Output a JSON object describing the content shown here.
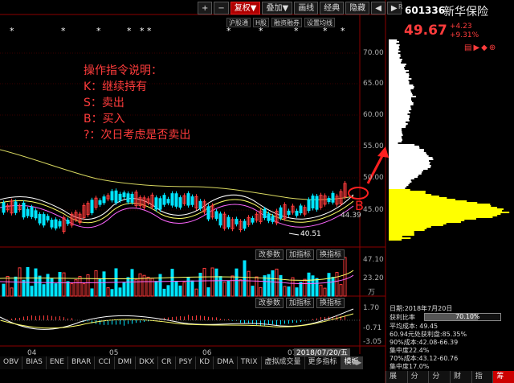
{
  "toolbar": {
    "buttons": [
      "+",
      "−",
      "复权▼",
      "叠加▼",
      "画线",
      "经典",
      "隐藏"
    ],
    "nav_left": "◀",
    "nav_right": "▶"
  },
  "sub_toolbar": {
    "buttons": [
      "沪股通",
      "H股",
      "融资融券",
      "设置均线"
    ]
  },
  "ticker": {
    "code": "601336",
    "name": "新华保险",
    "r_mark": "R"
  },
  "quote": {
    "price": "49.67",
    "change": "+4.23",
    "change_pct": "+9.31%"
  },
  "price_axis": [
    "70.00",
    "65.00",
    "60.00",
    "55.00",
    "50.00",
    "45.00"
  ],
  "annotations": {
    "low_price": "40.51",
    "right_price": "44.39",
    "b_marker": "B"
  },
  "instructions": [
    "操作指令说明：",
    "K：继续持有",
    "S：卖出",
    "B：买入",
    "?：次日考虑是否卖出"
  ],
  "volume_panel": {
    "buttons": [
      "改参数",
      "加指标",
      "换指标"
    ],
    "axis": [
      "47.10",
      "23.20",
      "万"
    ]
  },
  "macd_panel": {
    "buttons": [
      "改参数",
      "加指标",
      "换指标"
    ],
    "axis": [
      "1.70",
      "-0.71",
      "-3.05"
    ]
  },
  "x_axis": [
    "04",
    "05",
    "06",
    "07"
  ],
  "hover_date": "2018/07/20/五",
  "bottom_tabs": [
    "OBV",
    "BIAS",
    "ENE",
    "BRAR",
    "CCI",
    "DMI",
    "DKX",
    "CR",
    "PSY",
    "KD",
    "DMA",
    "TRIX",
    "虚拟成交量",
    "更多指标",
    "模板"
  ],
  "chip_info": [
    "日期:2018年7月20日",
    "获利比率",
    "70.10%",
    "平均成本: 49.45",
    "60.94元处获利盘:85.35%",
    "90%成本:42.08-66.39",
    "集中度22.4%",
    "70%成本:43.12-60.76",
    "集中度17.0%"
  ],
  "right_tabs": [
    "展开",
    "分笔",
    "分价",
    "财务",
    "指数",
    "筹码"
  ],
  "colors": {
    "up": "#ff3c3c",
    "down": "#00e5ff",
    "ma": "#ffff66",
    "chip": "#ffff00"
  }
}
